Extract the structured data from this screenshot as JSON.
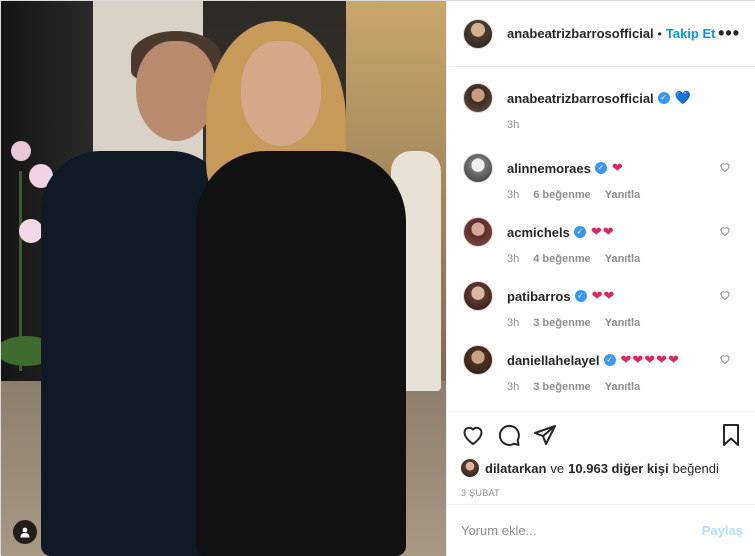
{
  "post": {
    "author": "anabeatrizbarrosofficial",
    "follow_label": "Takip Et",
    "dot": "•",
    "caption_emoji": "💙",
    "caption_time": "3h"
  },
  "comments": [
    {
      "user": "alinnemoraes",
      "emoji": "❤",
      "time": "3h",
      "likes": "6 beğenme",
      "reply": "Yanıtla"
    },
    {
      "user": "acmichels",
      "emoji": "❤❤",
      "time": "3h",
      "likes": "4 beğenme",
      "reply": "Yanıtla"
    },
    {
      "user": "patibarros",
      "emoji": "❤❤",
      "time": "3h",
      "likes": "3 beğenme",
      "reply": "Yanıtla"
    },
    {
      "user": "daniellahelayel",
      "emoji": "❤❤❤❤❤",
      "time": "3h",
      "likes": "3 beğenme",
      "reply": "Yanıtla"
    }
  ],
  "likes": {
    "first_user": "dilatarkan",
    "joiner": "ve",
    "others": "10.963 diğer kişi",
    "suffix": "beğendi"
  },
  "date": "3 ŞUBAT",
  "comment_box": {
    "placeholder": "Yorum ekle...",
    "post_label": "Paylaş"
  },
  "icons": {
    "more": "more-options-icon",
    "like": "heart-icon",
    "comment": "comment-icon",
    "share": "share-icon",
    "save": "bookmark-icon",
    "tag": "user-tag-icon"
  },
  "colors": {
    "accent": "#0095f6",
    "verified": "#3897f0",
    "muted": "#8e8e8e"
  }
}
